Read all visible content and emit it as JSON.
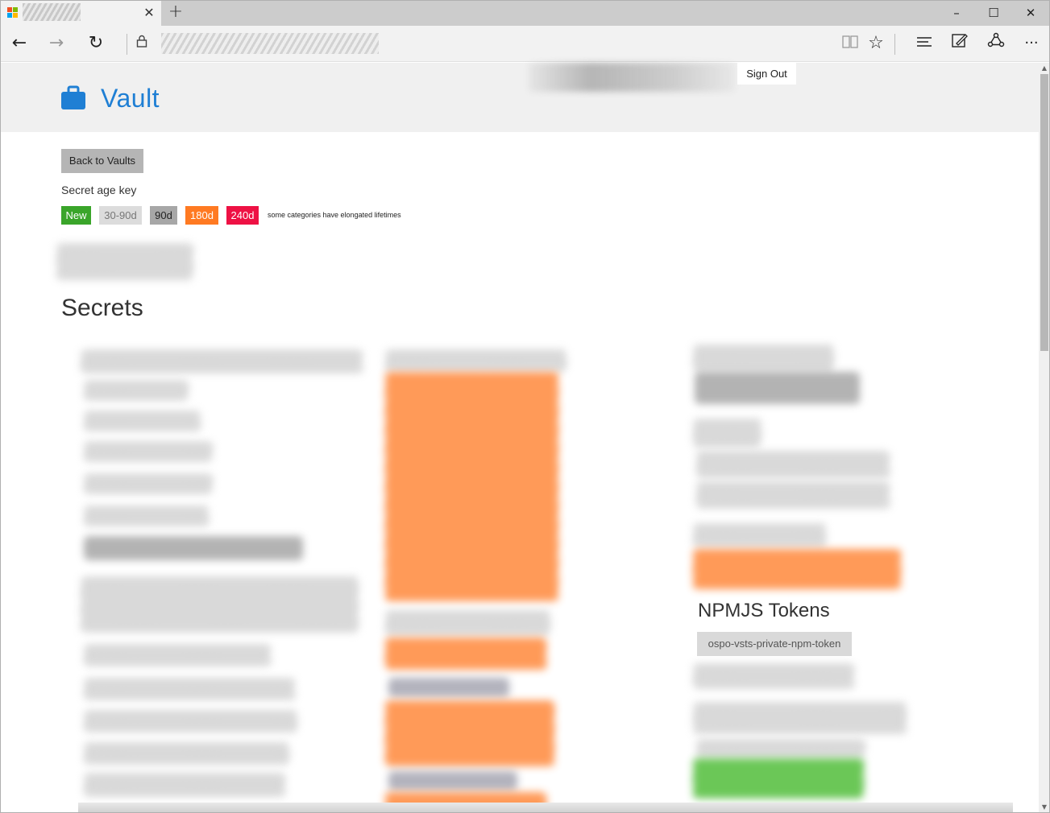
{
  "browser": {
    "tab_close": "✕",
    "new_tab": "+",
    "controls": {
      "minimize": "–",
      "maximize": "☐",
      "close": "✕"
    },
    "nav": {
      "back": "←",
      "forward": "→",
      "refresh": "↻",
      "lock": "🔒"
    },
    "toolbar": {
      "reading": "▯▯",
      "favorite": "☆",
      "hub": "≡",
      "notes": "✎",
      "share": "⟳",
      "more": "···"
    }
  },
  "header": {
    "title": "Vault",
    "brand_color": "#1f7fd4",
    "sign_out": "Sign Out"
  },
  "back_button": "Back to Vaults",
  "age_key": {
    "label": "Secret age key",
    "chips": [
      {
        "label": "New",
        "bg": "#3aa52a",
        "fg": "#ffffff"
      },
      {
        "label": "30-90d",
        "bg": "#dcdcdc",
        "fg": "#777777"
      },
      {
        "label": "90d",
        "bg": "#a7a7a7",
        "fg": "#222222"
      },
      {
        "label": "180d",
        "bg": "#ff7a22",
        "fg": "#ffffff"
      },
      {
        "label": "240d",
        "bg": "#ee1144",
        "fg": "#ffffff"
      }
    ],
    "note": "some categories have elongated lifetimes"
  },
  "secrets": {
    "title": "Secrets",
    "npm_section": {
      "title": "NPMJS Tokens",
      "items": [
        "ospo-vsts-private-npm-token"
      ]
    }
  }
}
